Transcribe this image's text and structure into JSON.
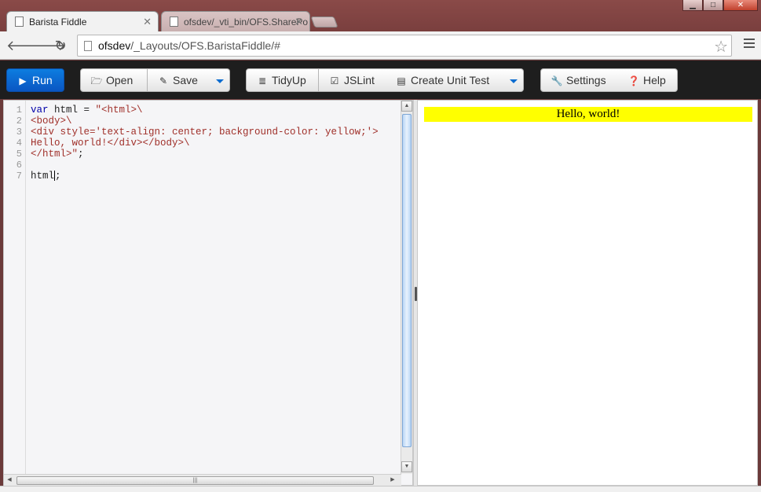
{
  "browser": {
    "tabs": [
      {
        "title": "Barista Fiddle",
        "active": true
      },
      {
        "title": "ofsdev/_vti_bin/OFS.SharePo",
        "active": false
      }
    ],
    "address": {
      "host": "ofsdev",
      "path": "/_Layouts/OFS.BaristaFiddle/#"
    },
    "window_controls": {
      "minimize": "▁",
      "maximize": "□",
      "close": "✕"
    }
  },
  "toolbar": {
    "run_label": "Run",
    "open_label": "Open",
    "save_label": "Save",
    "tidyup_label": "TidyUp",
    "jslint_label": "JSLint",
    "unit_test_label": "Create Unit Test",
    "settings_label": "Settings",
    "help_label": "Help",
    "run_color": "#0a6cd6"
  },
  "editor": {
    "line_numbers": [
      "1",
      "2",
      "3",
      "4",
      "5",
      "6",
      "7"
    ],
    "lines": [
      {
        "kw": "var",
        "plain": " html = ",
        "str": "\"<html>\\"
      },
      {
        "kw": "",
        "plain": "",
        "str": "<body>\\"
      },
      {
        "kw": "",
        "plain": "",
        "str": "<div style='text-align: center; background-color: yellow;'>"
      },
      {
        "kw": "",
        "plain": "",
        "str": "Hello, world!</div></body>\\"
      },
      {
        "kw": "",
        "plain": "",
        "str": "</html>\"",
        "tail": ";"
      },
      {
        "kw": "",
        "plain": "",
        "str": ""
      },
      {
        "kw": "",
        "plain": "html",
        "str": "",
        "tail": ";"
      }
    ]
  },
  "preview": {
    "output_text": "Hello, world!",
    "output_bg": "#ffff00"
  }
}
